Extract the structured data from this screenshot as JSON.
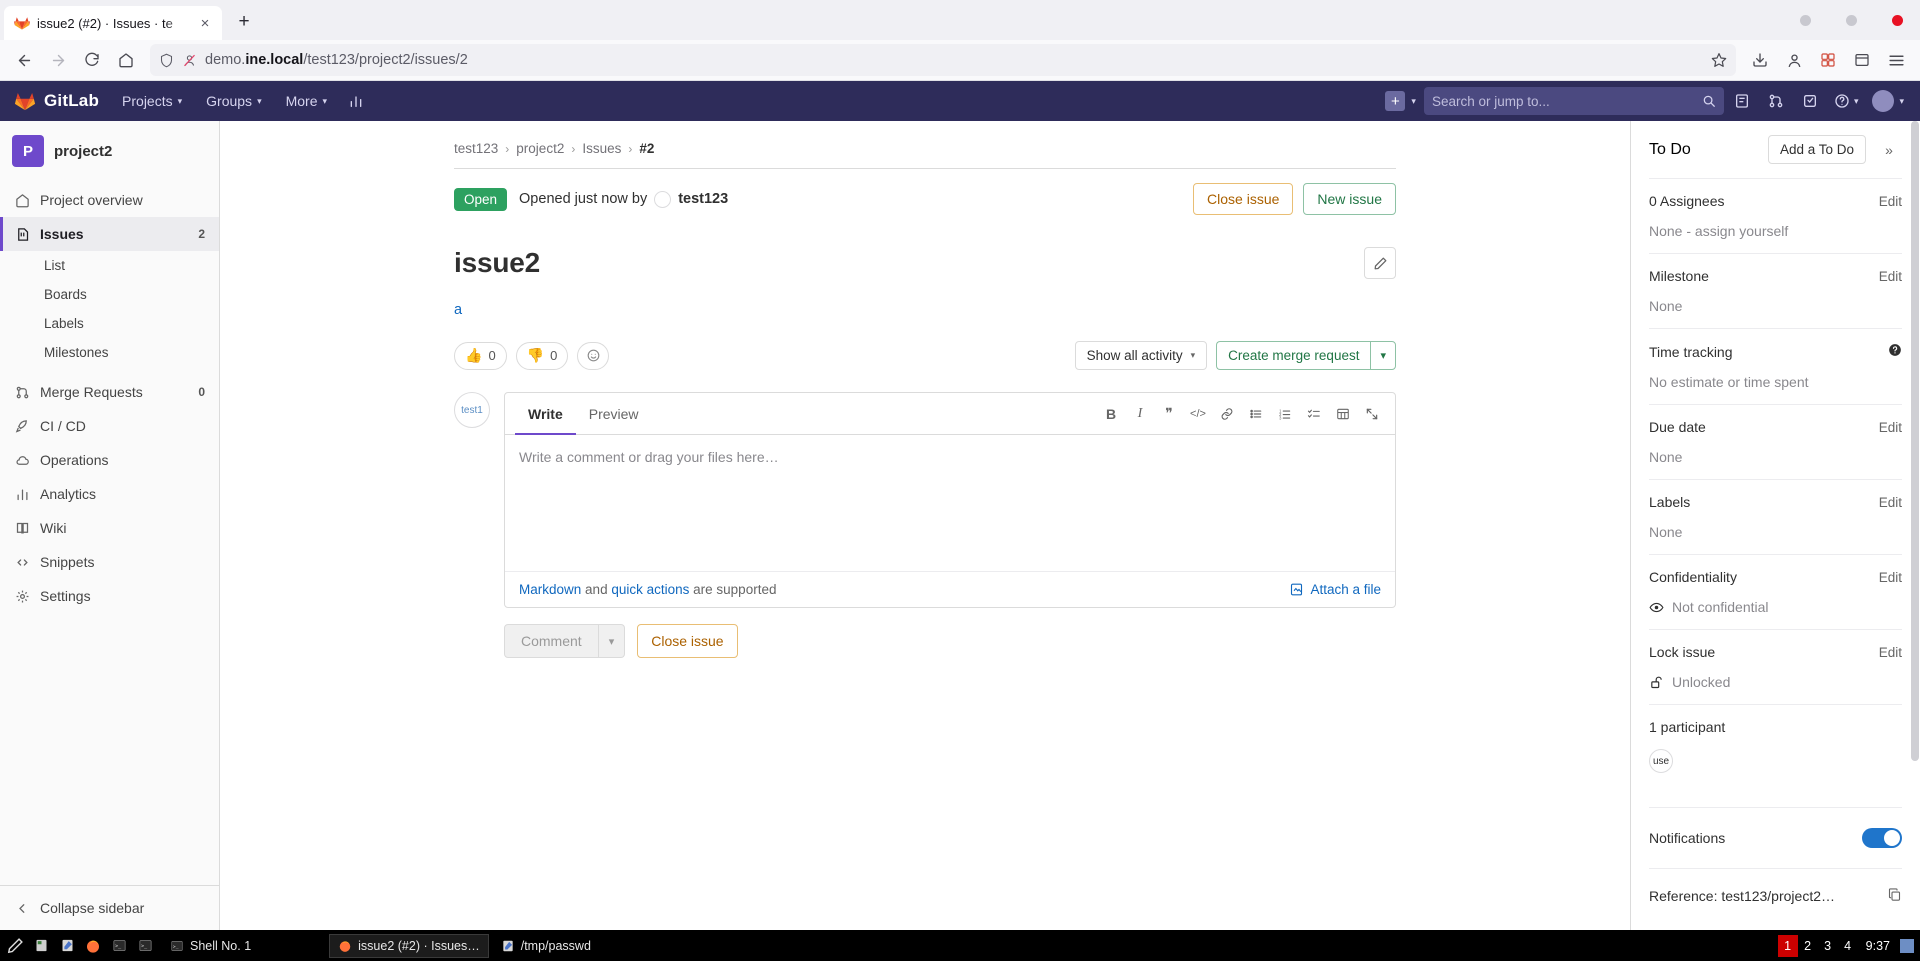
{
  "browser": {
    "tab": {
      "title": "issue2 (#2) · Issues · te",
      "favicon": "gitlab-fox-icon",
      "close": "×"
    },
    "newtab_label": "+",
    "url": {
      "prefix": "demo.",
      "bold": "ine.local",
      "suffix": "/test123/project2/issues/2"
    },
    "icons": {
      "back": "back-arrow-icon",
      "forward": "forward-arrow-icon",
      "reload": "reload-icon",
      "home": "home-icon",
      "shield": "shield-icon",
      "tracker": "tracker-blocked-icon",
      "bookmark": "bookmark-star-icon",
      "download": "download-icon",
      "account": "account-icon",
      "extension": "extension-icon",
      "library": "library-icon",
      "menu": "hamburger-menu-icon"
    }
  },
  "gitlab_nav": {
    "brand": "GitLab",
    "items": [
      {
        "label": "Projects",
        "caret": "▾"
      },
      {
        "label": "Groups",
        "caret": "▾"
      },
      {
        "label": "More",
        "caret": "▾"
      }
    ],
    "analytics_icon": "chart-icon",
    "plus_caret": "▾",
    "search_placeholder": "Search or jump to...",
    "right_icons": [
      "issues-icon",
      "merge-requests-icon",
      "todos-icon",
      "help-icon",
      "avatar-icon"
    ]
  },
  "sidebar": {
    "project": {
      "initial": "P",
      "name": "project2"
    },
    "items": [
      {
        "label": "Project overview",
        "icon": "home-icon",
        "badge": "",
        "active": false
      },
      {
        "label": "Issues",
        "icon": "issues-icon",
        "badge": "2",
        "active": true
      },
      {
        "label": "Merge Requests",
        "icon": "merge-icon",
        "badge": "0",
        "active": false
      },
      {
        "label": "CI / CD",
        "icon": "rocket-icon",
        "badge": "",
        "active": false
      },
      {
        "label": "Operations",
        "icon": "cloud-icon",
        "badge": "",
        "active": false
      },
      {
        "label": "Analytics",
        "icon": "analytics-icon",
        "badge": "",
        "active": false
      },
      {
        "label": "Wiki",
        "icon": "book-icon",
        "badge": "",
        "active": false
      },
      {
        "label": "Snippets",
        "icon": "snippet-icon",
        "badge": "",
        "active": false
      },
      {
        "label": "Settings",
        "icon": "gear-icon",
        "badge": "",
        "active": false
      }
    ],
    "sub_items": [
      "List",
      "Boards",
      "Labels",
      "Milestones"
    ],
    "collapse": {
      "label": "Collapse sidebar",
      "icon": "chevron-left-icon"
    }
  },
  "breadcrumb": {
    "items": [
      "test123",
      "project2",
      "Issues"
    ],
    "current": "#2",
    "sep": "›"
  },
  "issue": {
    "status": "Open",
    "opened_text": "Opened just now by",
    "author": "test123",
    "close_button": "Close issue",
    "new_button": "New issue",
    "title": "issue2",
    "description": "a",
    "edit_icon": "pencil-icon",
    "reactions": [
      {
        "emoji": "👍",
        "count": "0"
      },
      {
        "emoji": "👎",
        "count": "0"
      }
    ],
    "add_reaction_icon": "smiley-plus-icon",
    "activity_filter": "Show all activity",
    "merge_request_button": "Create merge request",
    "merge_request_caret": "▾"
  },
  "editor": {
    "avatar_text": "test1",
    "tabs": [
      {
        "label": "Write",
        "active": true
      },
      {
        "label": "Preview",
        "active": false
      }
    ],
    "toolbar": [
      "bold-icon",
      "italic-icon",
      "quote-icon",
      "code-icon",
      "link-icon",
      "bullet-list-icon",
      "numbered-list-icon",
      "task-list-icon",
      "table-icon",
      "fullscreen-icon"
    ],
    "toolbar_glyphs": [
      "B",
      "I",
      "❞",
      "</>",
      "🔗",
      "☰",
      "≡",
      "☑",
      "▦",
      "⤢"
    ],
    "placeholder": "Write a comment or drag your files here…",
    "footer": {
      "markdown": "Markdown",
      "and": "and",
      "quick_actions": "quick actions",
      "supported": "are supported",
      "attach": "Attach a file",
      "attach_icon": "paperclip-icon"
    },
    "comment_button": "Comment",
    "comment_caret": "▾",
    "close_button": "Close issue"
  },
  "right_sidebar": {
    "todo": {
      "label": "To Do",
      "button": "Add a To Do",
      "expand_icon": "chevrons-right-icon",
      "expand": "»"
    },
    "sections": [
      {
        "name": "assignees",
        "label": "0 Assignees",
        "action": "Edit",
        "value": "None - assign yourself",
        "icon": ""
      },
      {
        "name": "milestone",
        "label": "Milestone",
        "action": "Edit",
        "value": "None",
        "icon": ""
      },
      {
        "name": "time-tracking",
        "label": "Time tracking",
        "action": "help",
        "value": "No estimate or time spent",
        "icon": ""
      },
      {
        "name": "due-date",
        "label": "Due date",
        "action": "Edit",
        "value": "None",
        "icon": ""
      },
      {
        "name": "labels",
        "label": "Labels",
        "action": "Edit",
        "value": "None",
        "icon": ""
      },
      {
        "name": "confidentiality",
        "label": "Confidentiality",
        "action": "Edit",
        "value": "Not confidential",
        "icon": "eye-icon"
      },
      {
        "name": "lock-issue",
        "label": "Lock issue",
        "action": "Edit",
        "value": "Unlocked",
        "icon": "unlock-icon"
      }
    ],
    "participants": {
      "label": "1 participant",
      "avatar_text": "use"
    },
    "notifications": {
      "label": "Notifications",
      "enabled": true
    },
    "reference": {
      "label": "Reference: test123/project2…",
      "copy_icon": "copy-icon"
    },
    "help_icon": "question-circle-icon"
  },
  "taskbar": {
    "launchers": [
      "pencil-icon",
      "files-icon",
      "editor-icon",
      "firefox-icon",
      "terminal-icon",
      "terminal2-icon"
    ],
    "items": [
      {
        "label": "Shell No. 1",
        "icon": "terminal-icon",
        "active": false
      },
      {
        "label": "issue2 (#2) · Issues…",
        "icon": "firefox-icon",
        "active": true
      },
      {
        "label": "/tmp/passwd",
        "icon": "editor-icon",
        "active": false
      }
    ],
    "desktops": [
      "1",
      "2",
      "3",
      "4"
    ],
    "current_desktop": "1",
    "clock": "9:37"
  }
}
